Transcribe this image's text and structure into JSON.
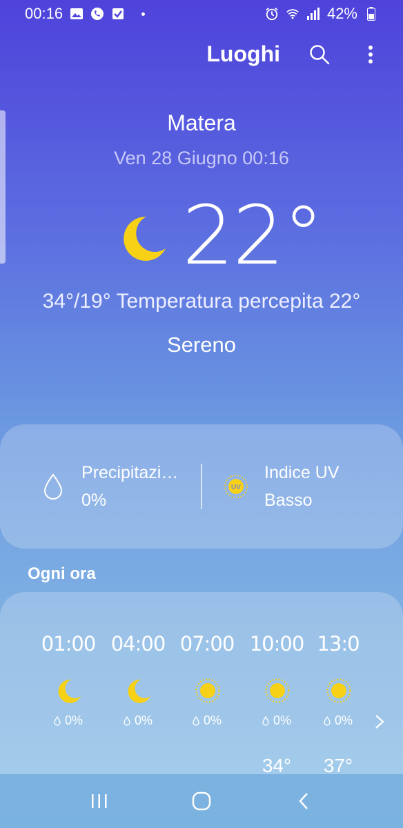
{
  "status_bar": {
    "time": "00:16",
    "battery": "42%"
  },
  "app_bar": {
    "title": "Luoghi",
    "search_icon": "search-icon",
    "menu_icon": "more-vert-icon"
  },
  "current": {
    "city": "Matera",
    "datetime": "Ven 28 Giugno 00:16",
    "temperature": "22°",
    "icon": "moon-icon",
    "hilo": "34°/19° Temperatura percepita 22°",
    "condition": "Sereno"
  },
  "details": {
    "precip_label": "Precipitazi…",
    "precip_value": "0%",
    "uv_label": "Indice UV",
    "uv_value": "Basso",
    "uv_badge": "UV"
  },
  "hourly": {
    "title": "Ogni ora",
    "hours": [
      {
        "time": "01:00",
        "icon": "moon-icon",
        "precip": "0%",
        "max": ""
      },
      {
        "time": "04:00",
        "icon": "moon-icon",
        "precip": "0%",
        "max": ""
      },
      {
        "time": "07:00",
        "icon": "sun-icon",
        "precip": "0%",
        "max": ""
      },
      {
        "time": "10:00",
        "icon": "sun-icon",
        "precip": "0%",
        "max": "34°"
      },
      {
        "time": "13:0",
        "icon": "sun-icon",
        "precip": "0%",
        "max": "37°"
      }
    ]
  },
  "colors": {
    "icon_yellow": "#f7d116",
    "bg_top": "#4e42db",
    "bg_bottom": "#8cc0e4"
  }
}
